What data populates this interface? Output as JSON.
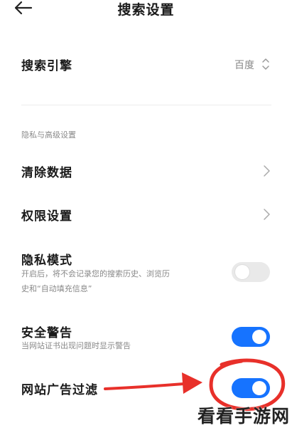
{
  "header": {
    "title": "搜索设置",
    "back_icon": "arrow-left-icon"
  },
  "search_engine": {
    "label": "搜索引擎",
    "value": "百度",
    "icon": "updown-chevron-icon"
  },
  "privacy_section": {
    "title": "隐私与高级设置"
  },
  "clear_data": {
    "label": "清除数据",
    "icon": "chevron-right-icon"
  },
  "permissions": {
    "label": "权限设置",
    "icon": "chevron-right-icon"
  },
  "private_mode": {
    "label": "隐私模式",
    "desc_line1": "开启后，将不会记录您的搜索历史、浏览历",
    "desc_line2": "史和“自动填充信息”",
    "enabled": false
  },
  "safety_warning": {
    "label": "安全警告",
    "desc": "当网站证书出现问题时显示警告",
    "enabled": true
  },
  "ad_filter": {
    "label": "网站广告过滤",
    "enabled": true
  },
  "annotation": {
    "arrow_color": "#e8302a",
    "circle_color": "#e8302a"
  },
  "watermark": {
    "text": "看看手游网"
  },
  "colors": {
    "toggle_on": "#1673ff",
    "toggle_off": "#e9e9e9",
    "annotation": "#e8302a"
  }
}
